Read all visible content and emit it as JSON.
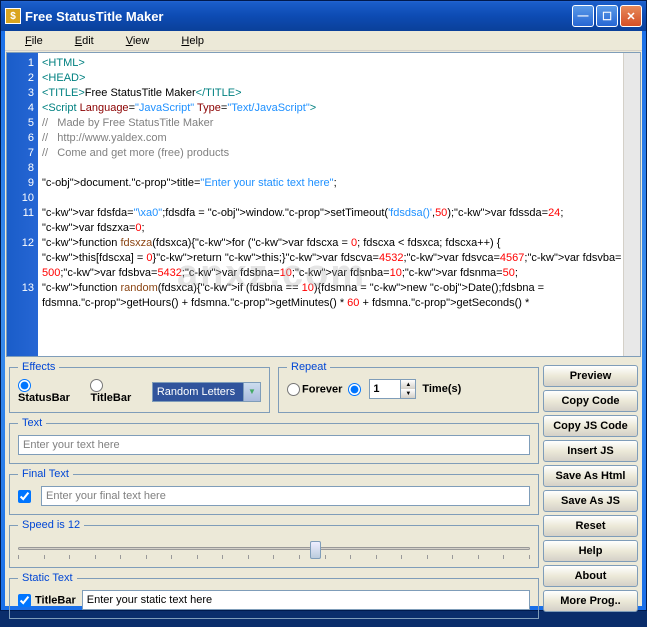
{
  "titlebar": {
    "icon": "$",
    "title": "Free StatusTitle Maker"
  },
  "menu": {
    "file": "File",
    "edit": "Edit",
    "view": "View",
    "help": "Help"
  },
  "gutter": [
    "1",
    "2",
    "3",
    "4",
    "5",
    "6",
    "7",
    "8",
    "9",
    "10",
    "11",
    "",
    "12",
    "",
    "",
    "13",
    ""
  ],
  "code_lines": [
    {
      "t": "tag",
      "raw": "<HTML>"
    },
    {
      "t": "tag",
      "raw": "<HEAD>"
    },
    {
      "t": "title",
      "pre": "<TITLE>",
      "txt": "Free StatusTitle Maker",
      "post": "</TITLE>"
    },
    {
      "t": "script",
      "raw": "<Script Language=\"JavaScript\" Type=\"Text/JavaScript\">"
    },
    {
      "t": "com",
      "raw": "//   Made by Free StatusTitle Maker"
    },
    {
      "t": "com",
      "raw": "//   http://www.yaldex.com"
    },
    {
      "t": "com",
      "raw": "//   Come and get more (free) products"
    },
    {
      "t": "blank",
      "raw": ""
    },
    {
      "t": "doctitle",
      "raw": "document.title=\"Enter your static text here\";"
    },
    {
      "t": "blank",
      "raw": ""
    },
    {
      "t": "var1",
      "raw": "var fdsfda=\"\\xa0\";fdsdfa = window.setTimeout('fdsdsa()',50);var fdssda=24;"
    },
    {
      "t": "var2",
      "raw": "var fdszxa=0;"
    },
    {
      "t": "fn1",
      "raw": "function fdsxza(fdsxca){for (var fdscxa = 0; fdscxa < fdsxca; fdscxa++) {"
    },
    {
      "t": "fn2",
      "raw": "this[fdscxa] = 0}return this;}var fdscva=4532;var fdsvca=4567;var fdsvba="
    },
    {
      "t": "fn3",
      "raw": "500;var fdsbva=5432;var fdsbna=10;var fdsnba=10;var fdsnma=50;"
    },
    {
      "t": "fn4",
      "raw": "function random(fdsxca){if (fdsbna == 10){fdsmna = new Date();fdsbna = "
    },
    {
      "t": "fn5",
      "raw": "fdsmna.getHours() + fdsmna.getMinutes() * 60 + fdsmna.getSeconds() * "
    }
  ],
  "effects": {
    "legend": "Effects",
    "statusbar": "StatusBar",
    "titlebar": "TitleBar",
    "combo": "Random Letters"
  },
  "repeat": {
    "legend": "Repeat",
    "forever": "Forever",
    "count": "1",
    "times": "Time(s)"
  },
  "text": {
    "legend": "Text",
    "placeholder": "Enter your text here"
  },
  "final": {
    "legend": "Final Text",
    "placeholder": "Enter your final text here"
  },
  "speed": {
    "legend": "Speed is 12"
  },
  "static": {
    "legend": "Static Text",
    "titlebar": "TitleBar",
    "placeholder": "Enter your static text here"
  },
  "buttons": {
    "preview": "Preview",
    "copycode": "Copy Code",
    "copyjs": "Copy JS Code",
    "insertjs": "Insert JS",
    "savehtml": "Save As Html",
    "savejs": "Save As JS",
    "reset": "Reset",
    "help": "Help",
    "about": "About",
    "more": "More Prog.."
  },
  "watermark": "anxz.com"
}
